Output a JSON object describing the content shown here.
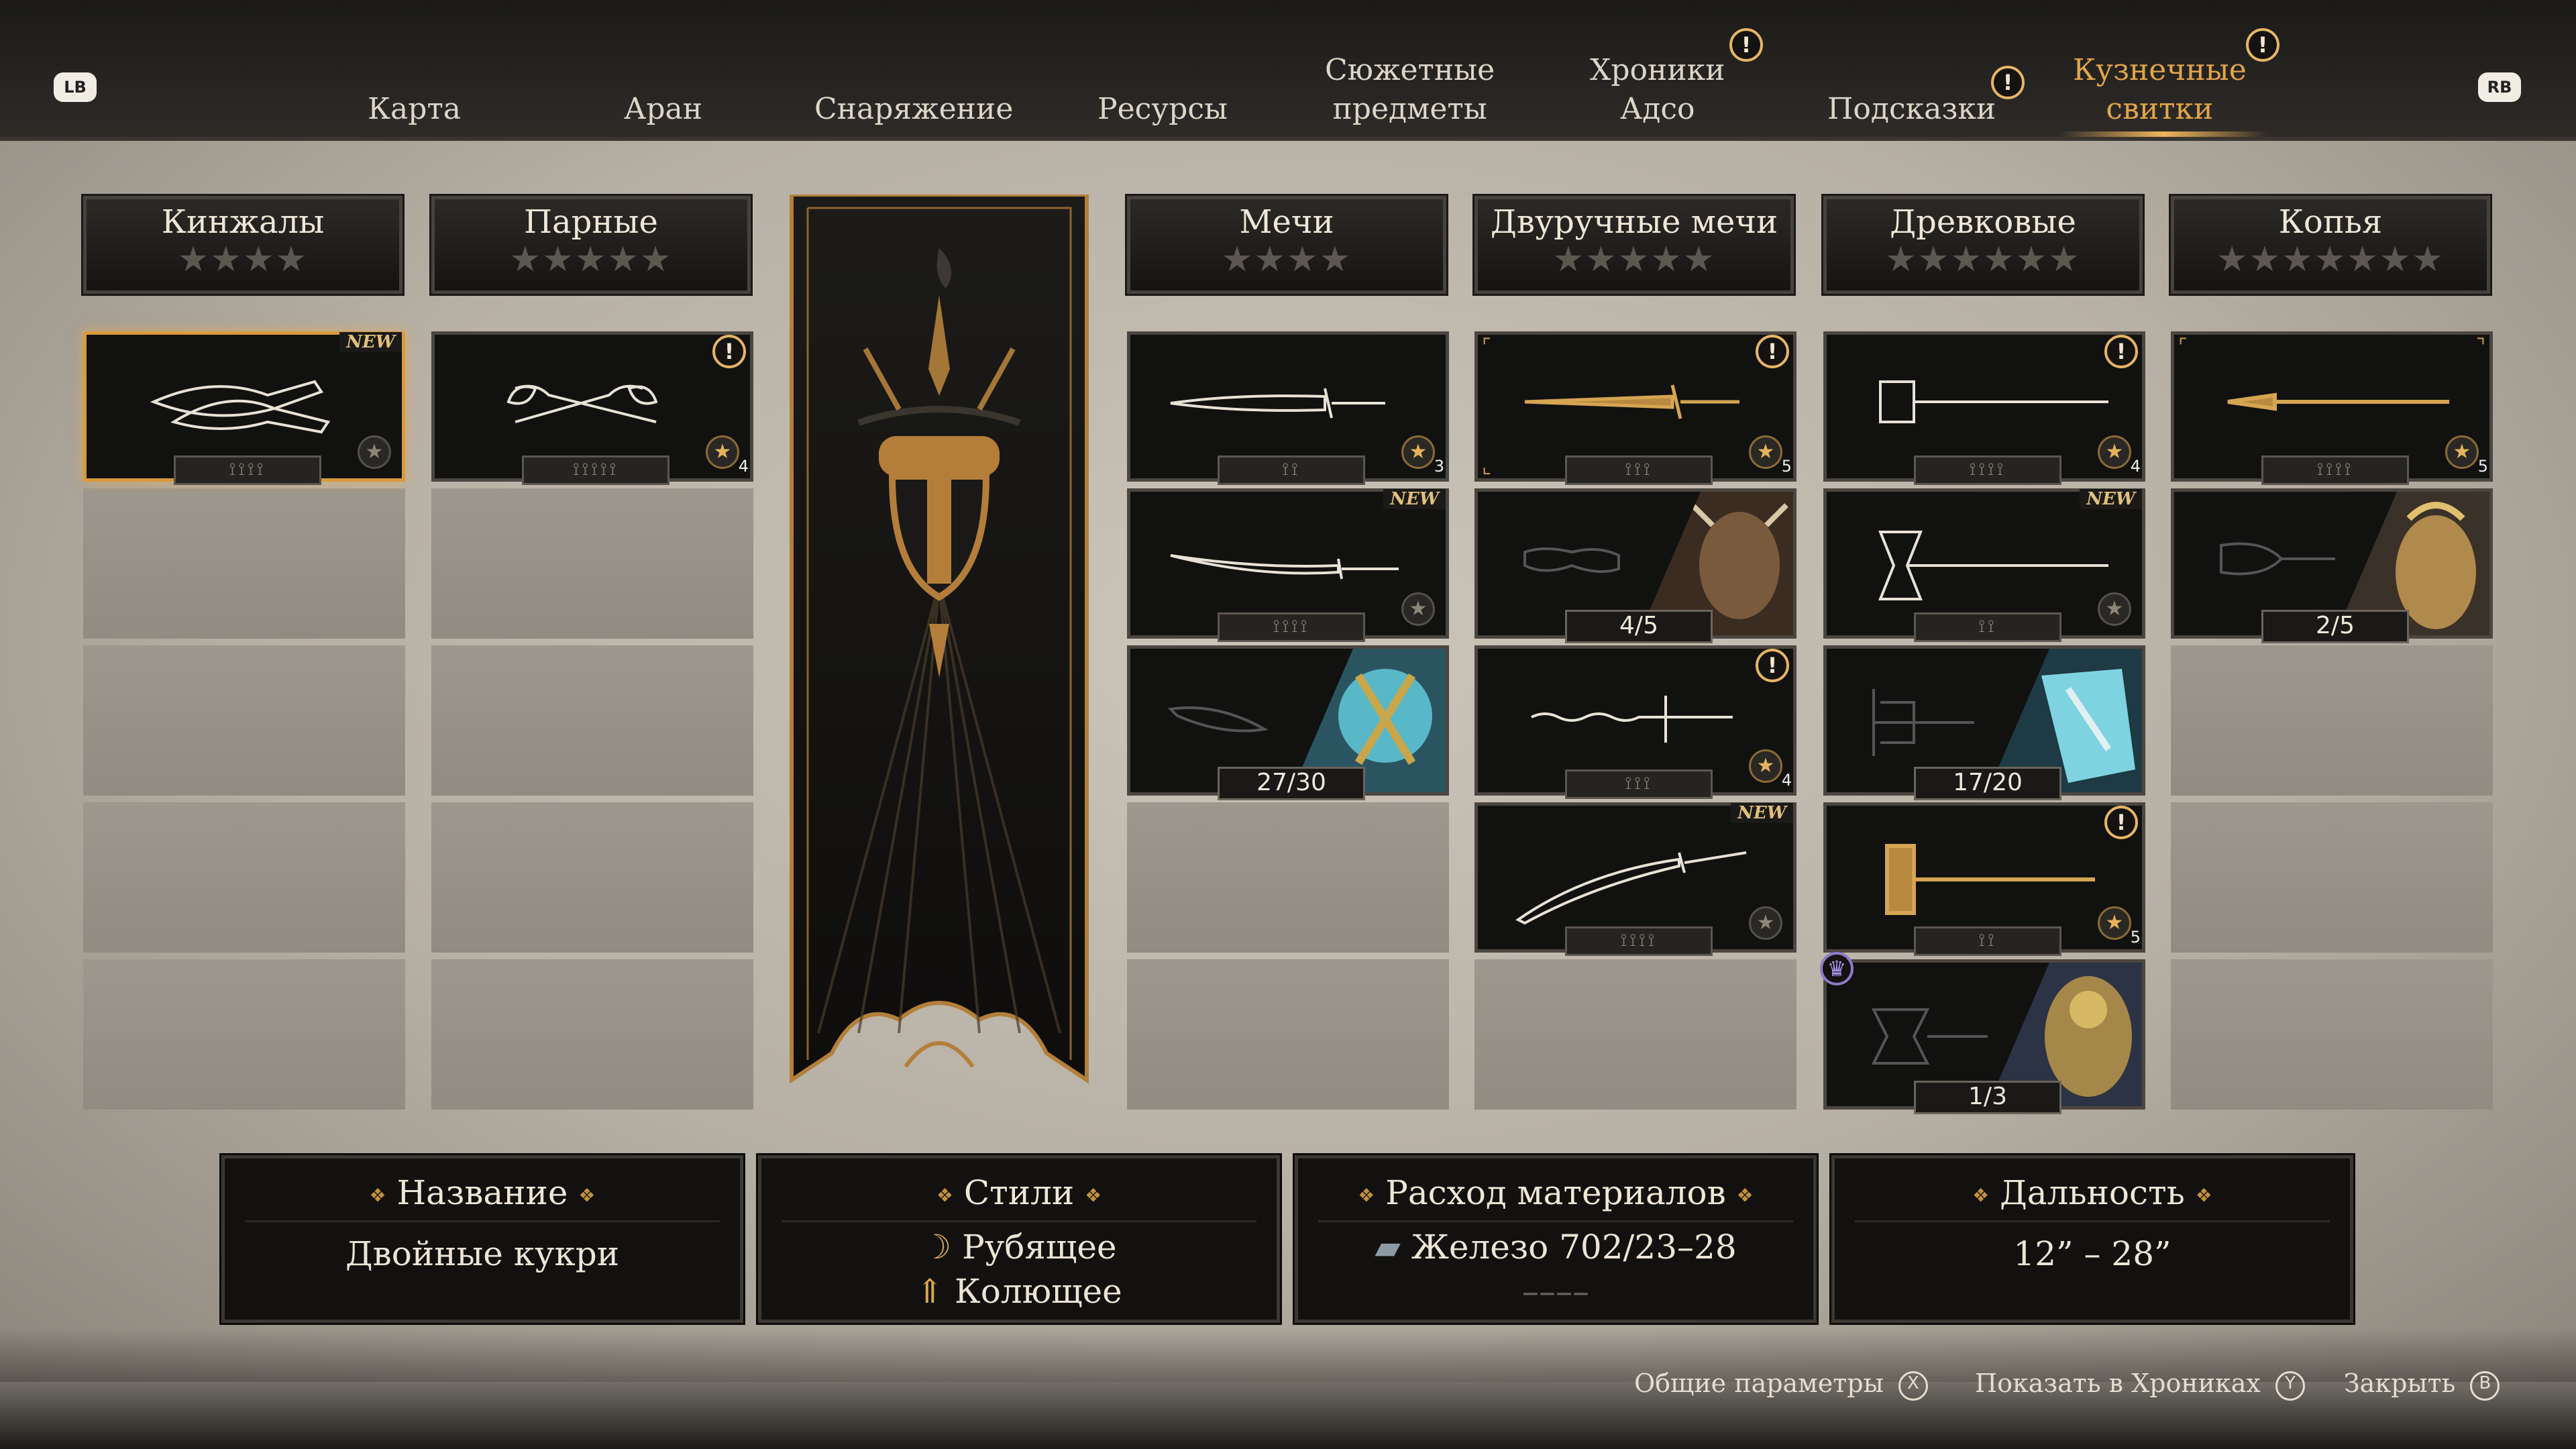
{
  "nav": {
    "lb": "LB",
    "rb": "RB",
    "tabs": [
      {
        "label": "Карта",
        "alert": false,
        "active": false
      },
      {
        "label": "Аран",
        "alert": false,
        "active": false
      },
      {
        "label": "Снаряжение",
        "alert": false,
        "active": false
      },
      {
        "label": "Ресурсы",
        "alert": false,
        "active": false
      },
      {
        "label": "Сюжетные\nпредметы",
        "alert": false,
        "active": false
      },
      {
        "label": "Хроники\nАдсо",
        "alert": true,
        "active": false
      },
      {
        "label": "Подсказки",
        "alert": true,
        "active": false
      },
      {
        "label": "Кузнечные\nсвитки",
        "alert": true,
        "active": true
      }
    ],
    "alert_glyph": "!"
  },
  "categories": [
    {
      "title": "Кинжалы",
      "stars": "★★★★"
    },
    {
      "title": "Парные",
      "stars": "★★★★★"
    },
    {
      "title": "Мечи",
      "stars": "★★★★"
    },
    {
      "title": "Двуручные мечи",
      "stars": "★★★★★"
    },
    {
      "title": "Древковые",
      "stars": "★★★★★★"
    },
    {
      "title": "Копья",
      "stars": "★★★★★★★"
    }
  ],
  "cards": {
    "c0_0": {
      "tiers": "⟟⟟⟟⟟",
      "badge": "NEW"
    },
    "c1_0": {
      "tiers": "⟟⟟⟟⟟⟟",
      "star": "4"
    },
    "c2_0": {
      "tiers": "⟟⟟",
      "star": "3"
    },
    "c2_1": {
      "tiers": "⟟⟟⟟⟟",
      "badge": "NEW"
    },
    "c2_2": {
      "progress": "27/30"
    },
    "c3_0": {
      "tiers": "⟟⟟⟟",
      "star": "5"
    },
    "c3_1": {
      "progress": "4/5"
    },
    "c3_2": {
      "tiers": "⟟⟟⟟",
      "star": "4"
    },
    "c3_3": {
      "tiers": "⟟⟟⟟⟟",
      "badge": "NEW"
    },
    "c4_0": {
      "tiers": "⟟⟟⟟⟟",
      "star": "4"
    },
    "c4_1": {
      "tiers": "⟟⟟",
      "badge": "NEW"
    },
    "c4_2": {
      "progress": "17/20"
    },
    "c4_3": {
      "tiers": "⟟⟟",
      "star": "5"
    },
    "c4_4": {
      "progress": "1/3"
    },
    "c5_0": {
      "tiers": "⟟⟟⟟⟟",
      "star": "5"
    },
    "c5_1": {
      "progress": "2/5"
    }
  },
  "info": {
    "name": {
      "header": "Название",
      "value": "Двойные кукри"
    },
    "styles": {
      "header": "Стили",
      "values": [
        "Рубящее",
        "Колющее"
      ]
    },
    "materials": {
      "header": "Расход материалов",
      "value": "Железо 702/23–28",
      "value2": "––––"
    },
    "range": {
      "header": "Дальность",
      "value": "12” – 28”"
    }
  },
  "footer": {
    "general": {
      "label": "Общие параметры",
      "glyph": "X"
    },
    "chronicles": {
      "label": "Показать в Хрониках",
      "glyph": "Y"
    },
    "close": {
      "label": "Закрыть",
      "glyph": "B"
    }
  },
  "colors": {
    "accent": "#e2a54a",
    "gold": "#c69547",
    "panel": "#121110"
  }
}
